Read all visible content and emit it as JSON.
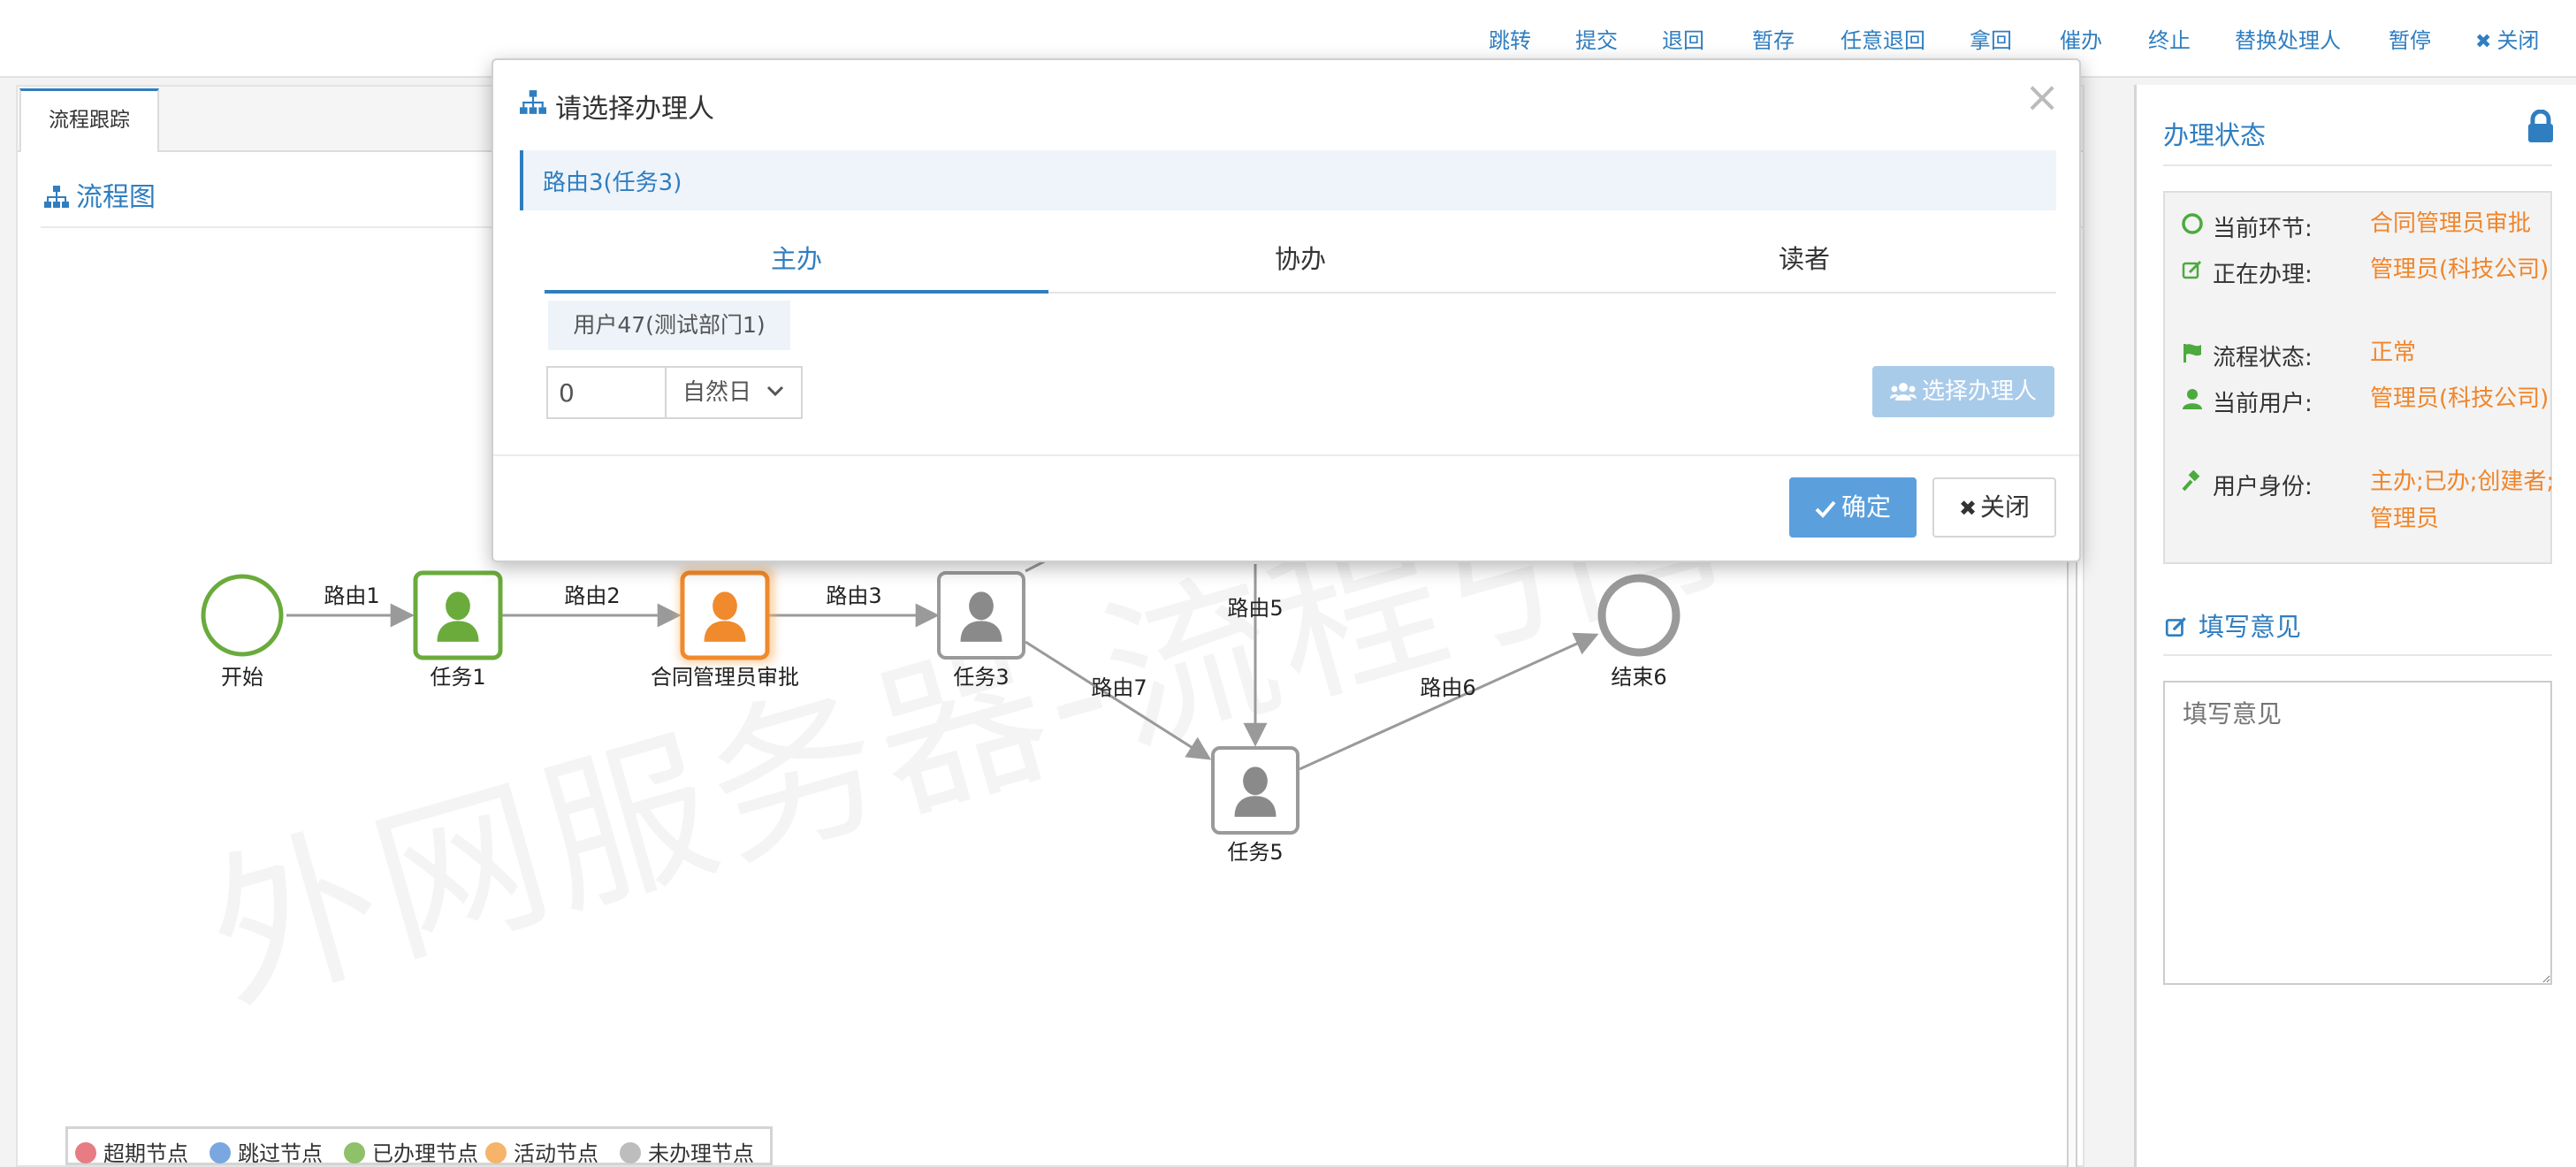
{
  "toolbar": {
    "buttons": [
      "跳转",
      "提交",
      "退回",
      "暂存",
      "任意退回",
      "拿回",
      "催办",
      "终止",
      "替换处理人",
      "暂停",
      "关闭"
    ]
  },
  "left_panel": {
    "tab": "流程跟踪",
    "section_title": "流程图",
    "watermark": "外网服务器-流程引擎",
    "legend": [
      {
        "label": "超期节点",
        "color": "#e77c82"
      },
      {
        "label": "跳过节点",
        "color": "#7aa7e0"
      },
      {
        "label": "已办理节点",
        "color": "#8fc06a"
      },
      {
        "label": "活动节点",
        "color": "#f6b36a"
      },
      {
        "label": "未办理节点",
        "color": "#bdbdbd"
      }
    ]
  },
  "diagram": {
    "nodes": {
      "start": "开始",
      "task1": "任务1",
      "approval": "合同管理员审批",
      "task3": "任务3",
      "task5": "任务5",
      "end6": "结束6"
    },
    "edges": {
      "r1": "路由1",
      "r2": "路由2",
      "r3": "路由3",
      "r5": "路由5",
      "r6": "路由6",
      "r7": "路由7"
    }
  },
  "right_panel": {
    "status_title": "办理状态",
    "rows": [
      {
        "label": "当前环节:",
        "value": "合同管理员审批",
        "icon": "circle-outline-icon"
      },
      {
        "label": "正在办理:",
        "value": "管理员(科技公司)",
        "icon": "edit-icon"
      },
      {
        "label": "流程状态:",
        "value": "正常",
        "icon": "flag-icon"
      },
      {
        "label": "当前用户:",
        "value": "管理员(科技公司)",
        "icon": "user-icon"
      },
      {
        "label": "用户身份:",
        "value": "主办;已办;创建者;管理员",
        "icon": "gavel-icon"
      }
    ],
    "opinion_title": "填写意见",
    "opinion_placeholder": "填写意见"
  },
  "modal": {
    "title": "请选择办理人",
    "info": "路由3(任务3)",
    "tabs": [
      "主办",
      "协办",
      "读者"
    ],
    "active_tab": "主办",
    "user_tag": "用户47(测试部门1)",
    "days_value": "0",
    "day_type": "自然日",
    "select_button": "选择办理人",
    "ok_button": "确定",
    "close_button": "关闭"
  },
  "colors": {
    "accent": "#2f7ec0",
    "done": "#6aab3c",
    "active": "#f08a2c",
    "pending": "#9a9a9a",
    "status_value": "#f0852a"
  }
}
